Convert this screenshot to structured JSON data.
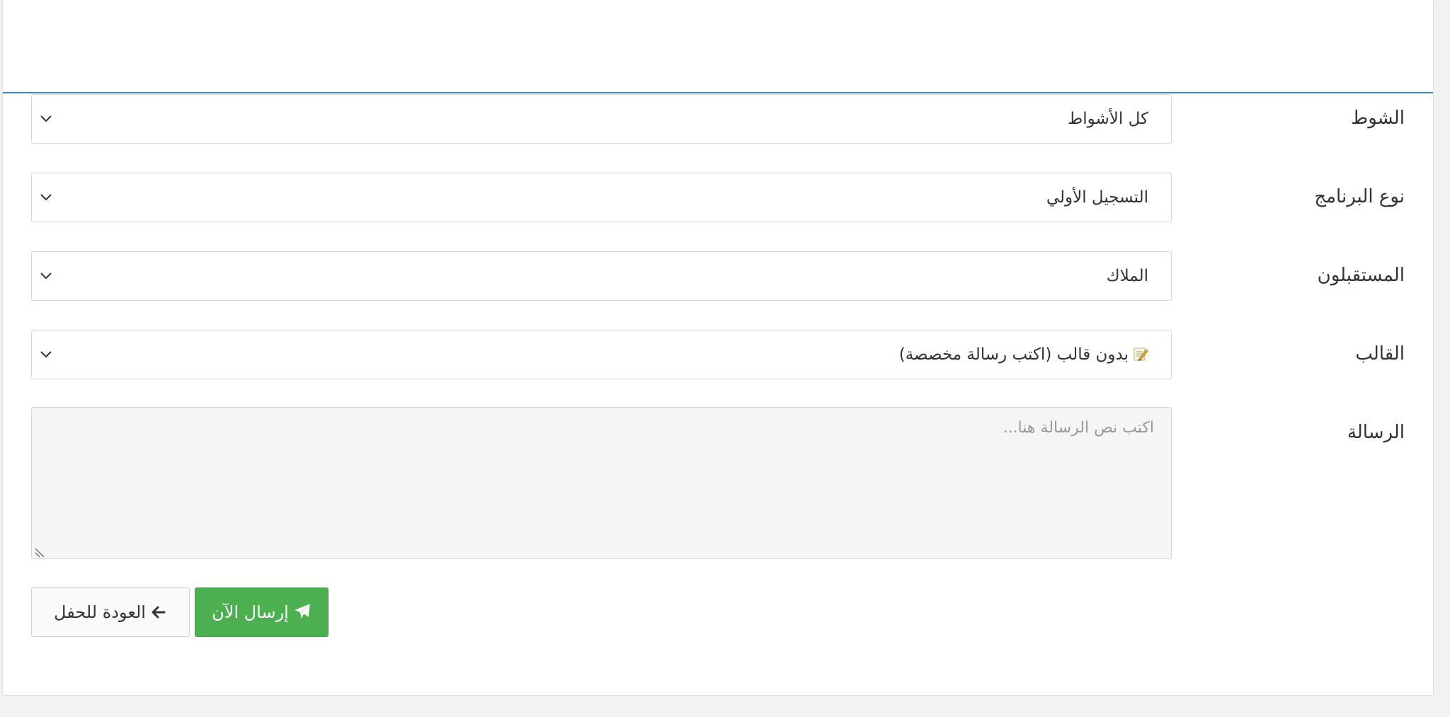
{
  "form": {
    "fields": [
      {
        "label": "الشوط",
        "value": "كل الأشواط"
      },
      {
        "label": "نوع البرنامج",
        "value": "التسجيل الأولي"
      },
      {
        "label": "المستقبلون",
        "value": "الملاك"
      },
      {
        "label": "القالب",
        "value": "بدون قالب (اكتب رسالة مخصصة)",
        "icon": "memo-icon"
      }
    ],
    "message": {
      "label": "الرسالة",
      "placeholder": "اكتب نص الرسالة هنا..."
    }
  },
  "actions": {
    "send_label": "إرسال الآن",
    "send_icon": "paper-plane-icon",
    "back_label": "العودة للحفل",
    "back_icon": "arrow-left-icon"
  },
  "colors": {
    "primary_border": "#3c8dbc",
    "success": "#4caf50"
  }
}
